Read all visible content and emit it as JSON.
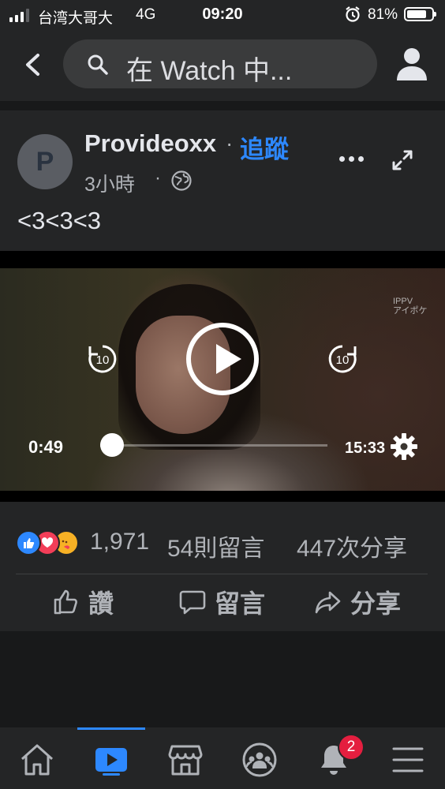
{
  "status_bar": {
    "carrier": "台湾大哥大",
    "network": "4G",
    "time": "09:20",
    "battery_percent": "81%",
    "battery_level": 0.81
  },
  "header": {
    "search_placeholder": "在 Watch 中..."
  },
  "post": {
    "avatar_letter": "P",
    "author": "Provideoxx",
    "separator": "·",
    "follow_label": "追蹤",
    "time": "3小時",
    "meta_separator": "·",
    "caption": "<3<3<3"
  },
  "video": {
    "watermark": "IPPV\nアイポケ",
    "current_time": "0:49",
    "total_time": "15:33",
    "progress_fraction": 0.0525,
    "skip_back_label": "10",
    "skip_forward_label": "10"
  },
  "engagement": {
    "reaction_count": "1,971",
    "comment_count": "54則留言",
    "share_count": "447次分享"
  },
  "actions": {
    "like_label": "讚",
    "comment_label": "留言",
    "share_label": "分享"
  },
  "tab_bar": {
    "active_tab": "watch",
    "notification_badge": "2"
  },
  "colors": {
    "background": "#18191a",
    "surface": "#242526",
    "accent": "#2d88ff",
    "badge": "#e41e3f"
  }
}
